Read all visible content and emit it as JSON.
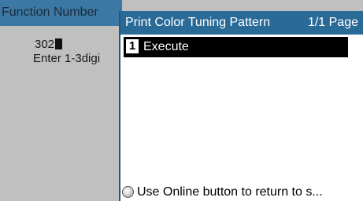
{
  "background_screen": {
    "title": "Function Number",
    "input_value": "302",
    "hint": "Enter 1-3digi"
  },
  "menu": {
    "title": "Print Color Tuning Pattern",
    "page_indicator": "1/1 Page",
    "items": [
      {
        "number": "1",
        "label": "Execute",
        "selected": true
      }
    ],
    "footer": "Use Online button to return to s..."
  },
  "icons": {
    "online_button": "online-button-icon",
    "text_cursor": "text-cursor-icon"
  },
  "colors": {
    "header_blue": "#2a6a97",
    "selection": "#000000",
    "dither_grey": "#d4d4d4"
  }
}
